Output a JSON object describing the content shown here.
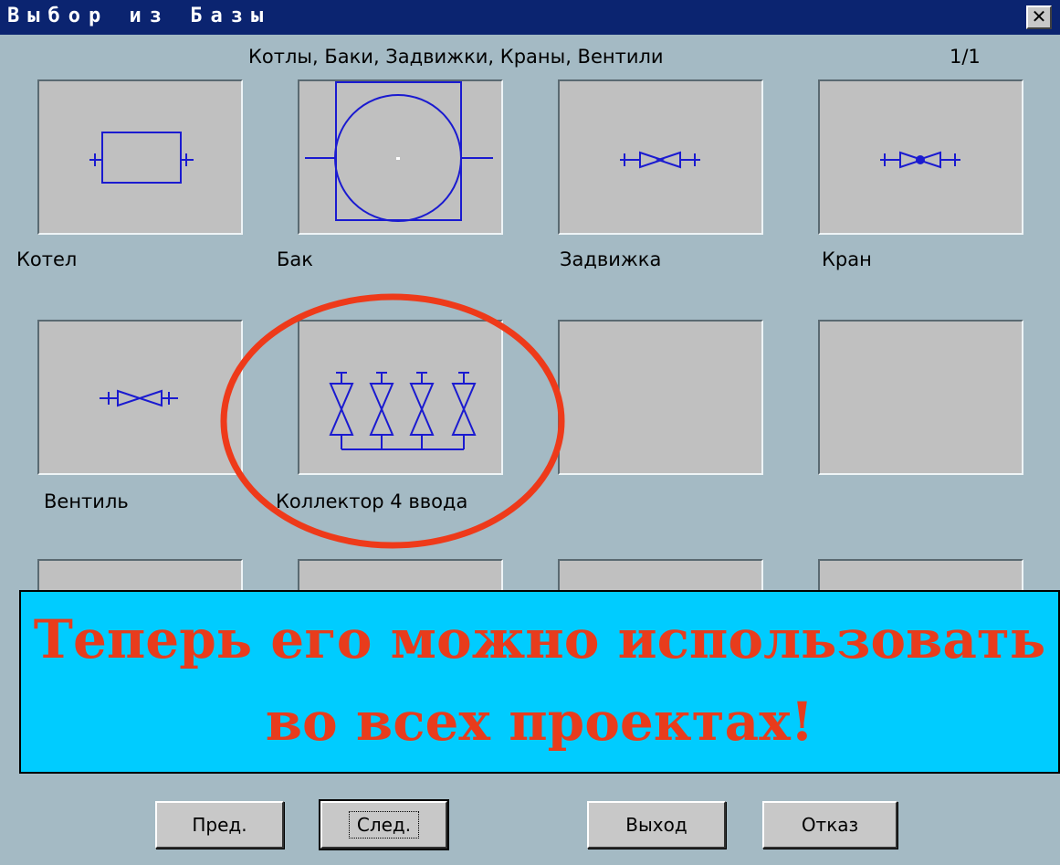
{
  "window": {
    "title": "Выбор из Базы",
    "close_glyph": "✕"
  },
  "header": {
    "category": "Котлы, Баки, Задвижки, Краны, Вентили",
    "page": "1/1"
  },
  "items": [
    {
      "label": "Котел",
      "icon": "boiler-icon"
    },
    {
      "label": "Бак",
      "icon": "tank-icon"
    },
    {
      "label": "Задвижка",
      "icon": "gate-valve-icon"
    },
    {
      "label": "Кран",
      "icon": "tap-icon"
    },
    {
      "label": "Вентиль",
      "icon": "globe-valve-icon"
    },
    {
      "label": "Коллектор 4 ввода",
      "icon": "manifold-4-inlets-icon"
    }
  ],
  "banner": {
    "line1": "Теперь его можно использовать",
    "line2": "во всех проектах!"
  },
  "buttons": {
    "prev": "Пред.",
    "next": "След.",
    "exit": "Выход",
    "cancel": "Отказ"
  },
  "colors": {
    "symbol": "#1a1ad0",
    "highlight": "#ee3a1a",
    "banner_bg": "#00ccff",
    "banner_text": "#e83c1c",
    "titlebar": "#0b2470"
  }
}
